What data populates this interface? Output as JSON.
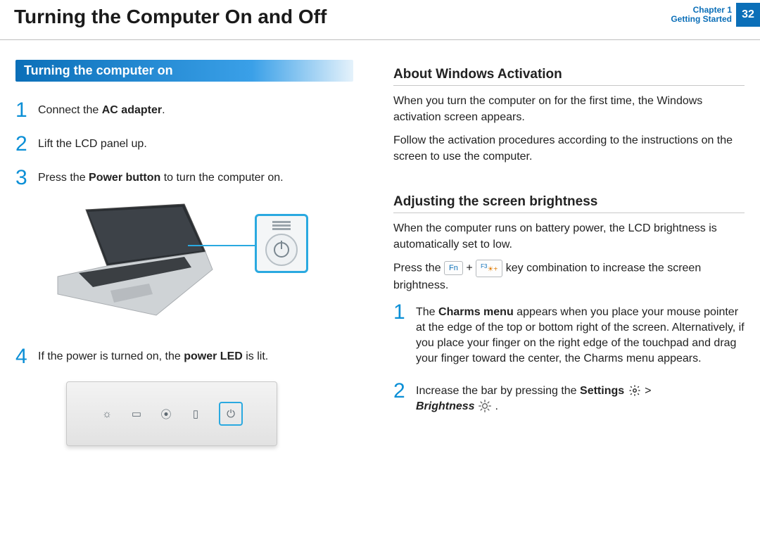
{
  "header": {
    "title": "Turning the Computer On and Off",
    "chapter_line1": "Chapter 1",
    "chapter_line2": "Getting Started",
    "page_number": "32"
  },
  "left": {
    "subheading": "Turning the computer on",
    "steps": [
      {
        "n": "1",
        "pre": "Connect the ",
        "bold": "AC adapter",
        "post": "."
      },
      {
        "n": "2",
        "pre": "Lift the LCD panel up.",
        "bold": "",
        "post": ""
      },
      {
        "n": "3",
        "pre": "Press the ",
        "bold": "Power button",
        "post": " to turn the computer on."
      },
      {
        "n": "4",
        "pre": "If the power is turned on, the ",
        "bold": "power LED",
        "post": " is lit."
      }
    ]
  },
  "right": {
    "activation_heading": "About Windows Activation",
    "activation_p1": "When you turn the computer on for the first time, the Windows activation screen appears.",
    "activation_p2": "Follow the activation procedures according to the instructions on the screen to use the computer.",
    "brightness_heading": "Adjusting the screen brightness",
    "brightness_p1": "When the computer runs on battery power, the LCD brightness is automatically set to low.",
    "brightness_line_pre": "Press the ",
    "key_fn": "Fn",
    "plus": " + ",
    "key_f3_label": "F3",
    "brightness_line_post": " key combination to increase the screen brightness.",
    "steps": [
      {
        "n": "1",
        "text_pre": "The ",
        "bold": "Charms menu",
        "text_post": " appears when you place your mouse pointer at the edge of the top or bottom right of the screen. Alternatively, if you place your finger on the right edge of the touchpad and drag your finger toward the center, the Charms menu appears."
      },
      {
        "n": "2",
        "text_pre": "Increase the bar by pressing the ",
        "bold": "Settings",
        "gt": " > ",
        "bold2": "Brightness",
        "period": " ."
      }
    ]
  }
}
